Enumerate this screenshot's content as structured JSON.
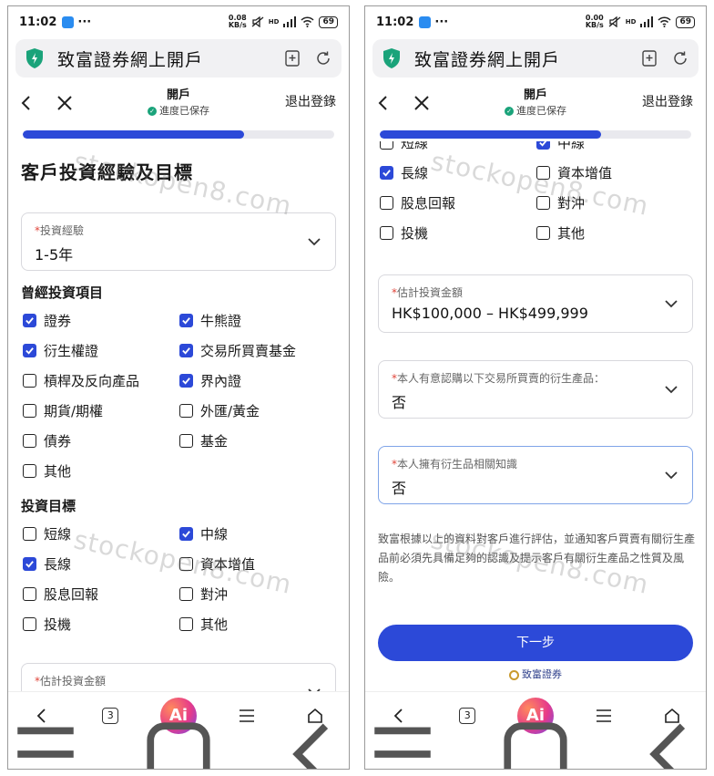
{
  "status": {
    "time": "11:02",
    "more": "···",
    "left_speed": "0.08\nKB/s",
    "right_speed": "0.00\nKB/s",
    "hd": "HD",
    "battery": "69"
  },
  "browser": {
    "page_title": "致富證券網上開戶"
  },
  "nav": {
    "title": "開戶",
    "saved": "進度已保存",
    "logout": "退出登錄"
  },
  "progress_fraction": 0.71,
  "form": {
    "heading": "客戶投資經驗及目標",
    "experience": {
      "label": "投資經驗",
      "value": "1-5年"
    },
    "past_products_title": "曾經投資項目",
    "past_products": [
      {
        "label": "證券",
        "checked": true
      },
      {
        "label": "牛熊證",
        "checked": true
      },
      {
        "label": "衍生權證",
        "checked": true
      },
      {
        "label": "交易所買賣基金",
        "checked": true
      },
      {
        "label": "槓桿及反向產品",
        "checked": false
      },
      {
        "label": "界內證",
        "checked": true
      },
      {
        "label": "期貨/期權",
        "checked": false
      },
      {
        "label": "外匯/黃金",
        "checked": false
      },
      {
        "label": "債券",
        "checked": false
      },
      {
        "label": "基金",
        "checked": false
      },
      {
        "label": "其他",
        "checked": false
      }
    ],
    "objectives_title": "投資目標",
    "objectives": [
      {
        "label": "短線",
        "checked": false
      },
      {
        "label": "中線",
        "checked": true
      },
      {
        "label": "長線",
        "checked": true
      },
      {
        "label": "資本增值",
        "checked": false
      },
      {
        "label": "股息回報",
        "checked": false
      },
      {
        "label": "對沖",
        "checked": false
      },
      {
        "label": "投機",
        "checked": false
      },
      {
        "label": "其他",
        "checked": false
      }
    ],
    "amount": {
      "label": "估計投資金額",
      "value": "HK$100,000 – HK$499,999"
    },
    "derivative_intent": {
      "label": "本人有意認購以下交易所買賣的衍生產品：",
      "value": "否"
    },
    "derivative_knowledge": {
      "label": "本人擁有衍生品相關知識",
      "value": "否"
    },
    "disclaimer": "致富根據以上的資料對客戶進行評估，並通知客戶買賣有關衍生產品前必須先具備足夠的認識及提示客戶有關衍生產品之性質及風險。",
    "next_button": "下一步",
    "brand": "致富證券"
  },
  "bottom_bar": {
    "tab_count": "3",
    "ai_label": "Ai"
  },
  "watermark": "stockopen8.com",
  "colors": {
    "primary": "#2c49d8",
    "required": "#e0453a",
    "shield": "#1aa37a"
  }
}
